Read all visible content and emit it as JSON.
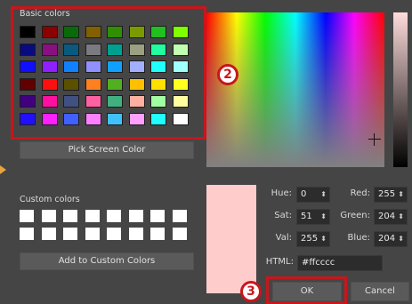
{
  "basic_colors": {
    "label": "Basic colors",
    "swatches": [
      [
        "#000000",
        "#8b0000",
        "#0a6a0a",
        "#806000",
        "#2f8f00",
        "#7a9a00",
        "#20c020",
        "#80ff00"
      ],
      [
        "#0a0a80",
        "#8a1080",
        "#0a5a80",
        "#7a7a80",
        "#00a090",
        "#9aa080",
        "#20ffa0",
        "#c0ffb0"
      ],
      [
        "#1010ff",
        "#9020ff",
        "#1080ff",
        "#9090ff",
        "#10a0ff",
        "#a0b0ff",
        "#20ffff",
        "#a0ffff"
      ],
      [
        "#600000",
        "#ff1010",
        "#5a5000",
        "#ff8020",
        "#50b020",
        "#ffc000",
        "#ffe000",
        "#ffff20"
      ],
      [
        "#400080",
        "#ff10a0",
        "#405080",
        "#ff60a0",
        "#40b080",
        "#ffb0a0",
        "#a0ffa0",
        "#ffffa0"
      ],
      [
        "#2010ff",
        "#ff20ff",
        "#4060ff",
        "#ff80ff",
        "#40c0ff",
        "#ffa0ff",
        "#20ffff",
        "#ffffff"
      ]
    ]
  },
  "pick_screen_color_label": "Pick Screen Color",
  "custom_colors": {
    "label": "Custom colors",
    "rows": 2,
    "cols": 8
  },
  "add_custom_label": "Add to Custom Colors",
  "fields": {
    "hue": {
      "label": "Hue:",
      "value": "0"
    },
    "sat": {
      "label": "Sat:",
      "value": "51"
    },
    "val": {
      "label": "Val:",
      "value": "255"
    },
    "red": {
      "label": "Red:",
      "value": "255"
    },
    "green": {
      "label": "Green:",
      "value": "204"
    },
    "blue": {
      "label": "Blue:",
      "value": "204"
    }
  },
  "html": {
    "label": "HTML:",
    "value": "#ffcccc"
  },
  "ok_label": "OK",
  "cancel_label": "Cancel",
  "badges": {
    "two": "2",
    "three": "3"
  },
  "current_color": "#ffcccc",
  "accent_red": "#c8161c"
}
